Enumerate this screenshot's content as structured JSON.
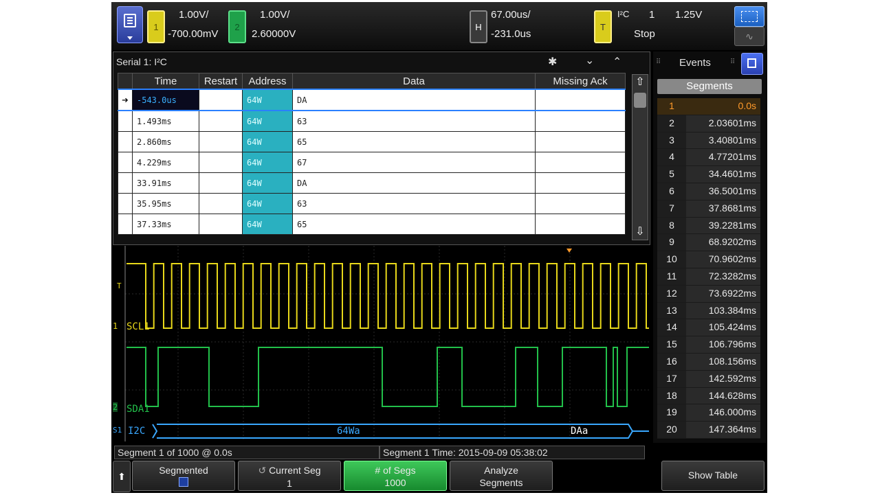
{
  "top": {
    "ch1": {
      "num": "1",
      "scale": "1.00V/",
      "offset": "-700.00mV"
    },
    "ch2": {
      "num": "2",
      "scale": "1.00V/",
      "offset": "2.60000V"
    },
    "horizontal": {
      "label": "H",
      "scale": "67.00us/",
      "position": "-231.0us"
    },
    "trigger": {
      "label": "T",
      "type": "I²C",
      "source": "1",
      "level": "1.25V",
      "status": "Stop"
    }
  },
  "serial": {
    "title": "Serial 1: I²C",
    "columns": [
      "Time",
      "Restart",
      "Address",
      "Data",
      "Missing Ack"
    ],
    "rows": [
      {
        "time": "-543.0us",
        "restart": "",
        "address": "64W",
        "data": "DA",
        "missing": ""
      },
      {
        "time": "1.493ms",
        "restart": "",
        "address": "64W",
        "data": "63",
        "missing": ""
      },
      {
        "time": "2.860ms",
        "restart": "",
        "address": "64W",
        "data": "65",
        "missing": ""
      },
      {
        "time": "4.229ms",
        "restart": "",
        "address": "64W",
        "data": "67",
        "missing": ""
      },
      {
        "time": "33.91ms",
        "restart": "",
        "address": "64W",
        "data": "DA",
        "missing": ""
      },
      {
        "time": "35.95ms",
        "restart": "",
        "address": "64W",
        "data": "63",
        "missing": ""
      },
      {
        "time": "37.33ms",
        "restart": "",
        "address": "64W",
        "data": "65",
        "missing": ""
      }
    ]
  },
  "events": {
    "title": "Events",
    "segments_label": "Segments",
    "segments": [
      {
        "n": "1",
        "t": "0.0s"
      },
      {
        "n": "2",
        "t": "2.03601ms"
      },
      {
        "n": "3",
        "t": "3.40801ms"
      },
      {
        "n": "4",
        "t": "4.77201ms"
      },
      {
        "n": "5",
        "t": "34.4601ms"
      },
      {
        "n": "6",
        "t": "36.5001ms"
      },
      {
        "n": "7",
        "t": "37.8681ms"
      },
      {
        "n": "8",
        "t": "39.2281ms"
      },
      {
        "n": "9",
        "t": "68.9202ms"
      },
      {
        "n": "10",
        "t": "70.9602ms"
      },
      {
        "n": "11",
        "t": "72.3282ms"
      },
      {
        "n": "12",
        "t": "73.6922ms"
      },
      {
        "n": "13",
        "t": "103.384ms"
      },
      {
        "n": "14",
        "t": "105.424ms"
      },
      {
        "n": "15",
        "t": "106.796ms"
      },
      {
        "n": "16",
        "t": "108.156ms"
      },
      {
        "n": "17",
        "t": "142.592ms"
      },
      {
        "n": "18",
        "t": "144.628ms"
      },
      {
        "n": "19",
        "t": "146.000ms"
      },
      {
        "n": "20",
        "t": "147.364ms"
      }
    ]
  },
  "waveform": {
    "scl_label": "SCL1",
    "sda_label": "SDA1",
    "bus_label": "I2C",
    "bus_address": "64Wa",
    "bus_data": "DAa",
    "ch1_marker": "1",
    "ch2_marker": "2",
    "trigger_marker": "T",
    "serial_marker": "S1",
    "scl_color": "#e8d81a",
    "sda_color": "#22c04a",
    "bus_color": "#3aa8ff"
  },
  "status": {
    "left": "Segment 1 of 1000 @ 0.0s",
    "right": "Segment 1 Time: 2015-09-09 05:38:02"
  },
  "softkeys": {
    "segmented": {
      "l1": "Segmented",
      "l2": ""
    },
    "current_seg": {
      "l1": "Current Seg",
      "l2": "1"
    },
    "num_segs": {
      "l1": "# of Segs",
      "l2": "1000"
    },
    "analyze": {
      "l1": "Analyze",
      "l2": "Segments"
    },
    "show_table": {
      "l1": "Show Table"
    }
  }
}
